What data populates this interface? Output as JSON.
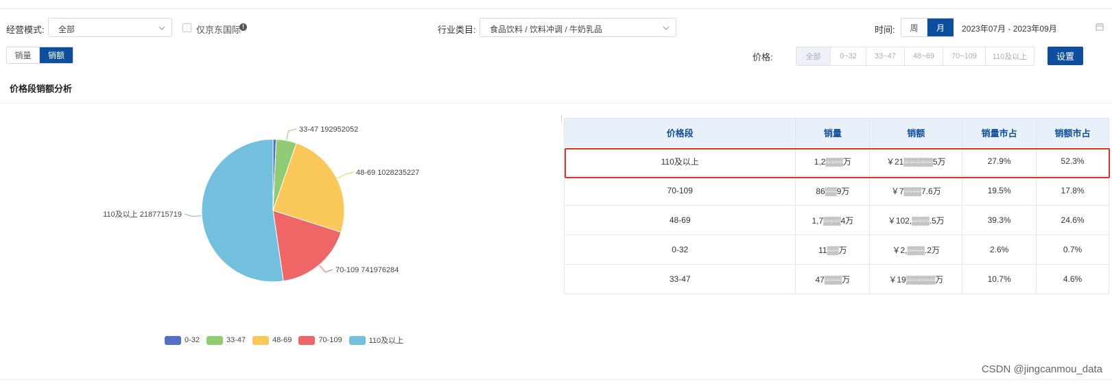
{
  "filters": {
    "mode_label": "经营模式:",
    "mode_value": "全部",
    "jd_intl_label": "仅京东国际",
    "industry_label": "行业类目:",
    "industry_value": "食品饮料 / 饮料冲调 / 牛奶乳品",
    "time_label": "时间:",
    "time_options": [
      "周",
      "月"
    ],
    "time_active": "月",
    "date_range": "2023年07月 - 2023年09月",
    "metric_options": [
      "销量",
      "销额"
    ],
    "metric_active": "销额",
    "price_label": "价格:",
    "price_options": [
      "全部",
      "0~32",
      "33~47",
      "48~69",
      "70~109",
      "110及以上"
    ],
    "price_active": "全部",
    "settings_button": "设置"
  },
  "section": {
    "title": "价格段销额分析"
  },
  "chart_data": {
    "type": "pie",
    "categories": [
      "0-32",
      "33-47",
      "48-69",
      "70-109",
      "110及以上"
    ],
    "values": [
      30000000,
      192952052,
      1028235227,
      741976284,
      2187715719
    ],
    "labels": [
      {
        "name": "33-47",
        "value": "192952052"
      },
      {
        "name": "48-69",
        "value": "1028235227"
      },
      {
        "name": "70-109",
        "value": "741976284"
      },
      {
        "name": "110及以上",
        "value": "2187715719"
      }
    ],
    "colors": [
      "#5470c6",
      "#91cc75",
      "#fac858",
      "#ee6666",
      "#73c0de"
    ],
    "legend": "bottom"
  },
  "table": {
    "headers": [
      "价格段",
      "销量",
      "销额",
      "销量市占",
      "销额市占"
    ],
    "rows": [
      [
        "110及以上",
        "1,2▒▒▒万",
        "￥21▒▒▒▒▒5万",
        "27.9%",
        "52.3%"
      ],
      [
        "70-109",
        "86▒▒9万",
        "￥7▒▒▒7.6万",
        "19.5%",
        "17.8%"
      ],
      [
        "48-69",
        "1,7▒▒▒4万",
        "￥102,▒▒▒.5万",
        "39.3%",
        "24.6%"
      ],
      [
        "0-32",
        "11▒▒万",
        "￥2,▒▒▒.2万",
        "2.6%",
        "0.7%"
      ],
      [
        "33-47",
        "47▒▒▒万",
        "￥19▒▒▒▒▒万",
        "10.7%",
        "4.6%"
      ]
    ],
    "highlighted_row": 0
  },
  "watermark": "CSDN @jingcanmou_data"
}
